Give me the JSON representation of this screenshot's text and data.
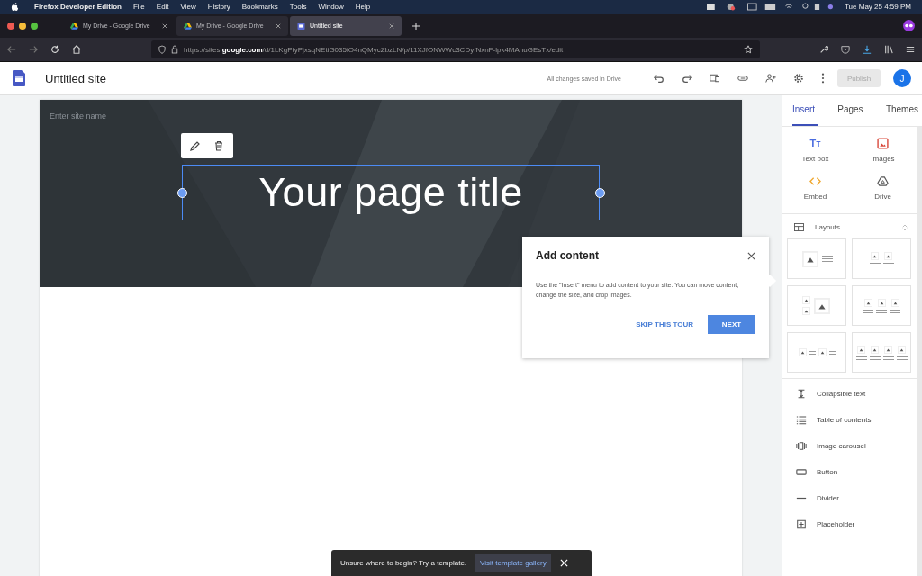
{
  "menubar": {
    "app": "Firefox Developer Edition",
    "menus": [
      "File",
      "Edit",
      "View",
      "History",
      "Bookmarks",
      "Tools",
      "Window",
      "Help"
    ],
    "clock": "Tue May 25  4:59 PM"
  },
  "tabs": [
    {
      "label": "My Drive - Google Drive",
      "kind": "drive",
      "selected": false
    },
    {
      "label": "My Drive - Google Drive",
      "kind": "drive",
      "selected": false
    },
    {
      "label": "Untitled site",
      "kind": "sites",
      "selected": true
    }
  ],
  "url": "https://sites.**google.com**/d/1LKgPtyPjxsqNEtiG035iO4nQMycZbzLN/p/11XJfONWWc3CDyfNxnF-lpk4MAhuGEsTx/edit",
  "site": {
    "title": "Untitled site",
    "save_status": "All changes saved in Drive",
    "publish": "Publish",
    "avatar": "J"
  },
  "banner": {
    "site_name_placeholder": "Enter site name",
    "page_title": "Your page title"
  },
  "panel": {
    "tabs": [
      {
        "label": "Insert",
        "selected": true
      },
      {
        "label": "Pages",
        "selected": false
      },
      {
        "label": "Themes",
        "selected": false
      }
    ],
    "insert_items": [
      {
        "label": "Text box",
        "kind": "textbox",
        "glyph": "Tт"
      },
      {
        "label": "Images",
        "kind": "images"
      },
      {
        "label": "Embed",
        "kind": "embed"
      },
      {
        "label": "Drive",
        "kind": "drive"
      }
    ],
    "layouts_label": "Layouts",
    "layouts": [
      {
        "kind": "image-text"
      },
      {
        "kind": "two-cards"
      },
      {
        "kind": "mixed"
      },
      {
        "kind": "three-cards"
      },
      {
        "kind": "two-inline"
      },
      {
        "kind": "four-cards"
      }
    ],
    "components": [
      {
        "label": "Collapsible text",
        "kind": "collapsible"
      },
      {
        "label": "Table of contents",
        "kind": "toc"
      },
      {
        "label": "Image carousel",
        "kind": "carousel"
      },
      {
        "label": "Button",
        "kind": "button"
      },
      {
        "label": "Divider",
        "kind": "divider"
      },
      {
        "label": "Placeholder",
        "kind": "placeholder"
      }
    ]
  },
  "tour": {
    "title": "Add content",
    "body": "Use the \"Insert\" menu to add content to your site. You can move content, change the size, and crop images.",
    "skip": "SKIP THIS TOUR",
    "next": "NEXT"
  },
  "snackbar": {
    "text": "Unsure where to begin? Try a template.",
    "link": "Visit template gallery"
  }
}
